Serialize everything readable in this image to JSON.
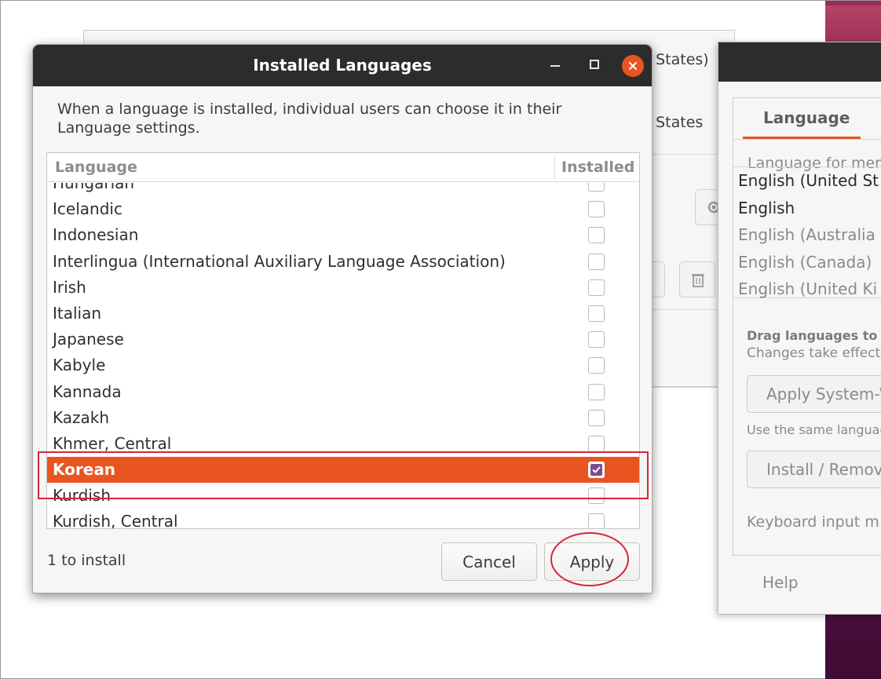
{
  "background_window": {
    "partial_text_1": "d States)",
    "partial_text_2": "d States"
  },
  "right_window": {
    "tab_label": "Language",
    "menu_label": "Language for men",
    "languages": [
      {
        "label": "English (United St",
        "emphasis": "strong"
      },
      {
        "label": "English",
        "emphasis": "strong"
      },
      {
        "label": "English (Australia",
        "emphasis": "weak"
      },
      {
        "label": "English (Canada)",
        "emphasis": "weak"
      },
      {
        "label": "English (United Ki",
        "emphasis": "weak"
      }
    ],
    "drag_hint_bold": "Drag languages to ar",
    "drag_hint": "Changes take effect n",
    "apply_system_label": "Apply System-W",
    "use_same_hint": "Use the same languag",
    "install_remove_label": "Install / Remove",
    "keyboard_label": "Keyboard input m",
    "help_label": "Help"
  },
  "dialog": {
    "title": "Installed Languages",
    "description": "When a language is installed, individual users can choose it in their Language settings.",
    "columns": {
      "language": "Language",
      "installed": "Installed"
    },
    "rows": [
      {
        "name": "Hungarian",
        "installed": false,
        "selected": false
      },
      {
        "name": "Icelandic",
        "installed": false,
        "selected": false
      },
      {
        "name": "Indonesian",
        "installed": false,
        "selected": false
      },
      {
        "name": "Interlingua (International Auxiliary Language Association)",
        "installed": false,
        "selected": false
      },
      {
        "name": "Irish",
        "installed": false,
        "selected": false
      },
      {
        "name": "Italian",
        "installed": false,
        "selected": false
      },
      {
        "name": "Japanese",
        "installed": false,
        "selected": false
      },
      {
        "name": "Kabyle",
        "installed": false,
        "selected": false
      },
      {
        "name": "Kannada",
        "installed": false,
        "selected": false
      },
      {
        "name": "Kazakh",
        "installed": false,
        "selected": false
      },
      {
        "name": "Khmer, Central",
        "installed": false,
        "selected": false
      },
      {
        "name": "Korean",
        "installed": true,
        "selected": true
      },
      {
        "name": "Kurdish",
        "installed": false,
        "selected": false
      },
      {
        "name": "Kurdish, Central",
        "installed": false,
        "selected": false
      }
    ],
    "status": "1 to install",
    "cancel_label": "Cancel",
    "apply_label": "Apply"
  },
  "colors": {
    "accent": "#e95420",
    "titlebar": "#2c2c2c",
    "annotation": "#d7243a"
  },
  "icons": [
    "minimize-icon",
    "maximize-icon",
    "close-icon",
    "checkmark-icon",
    "gear-icon",
    "trash-icon"
  ]
}
